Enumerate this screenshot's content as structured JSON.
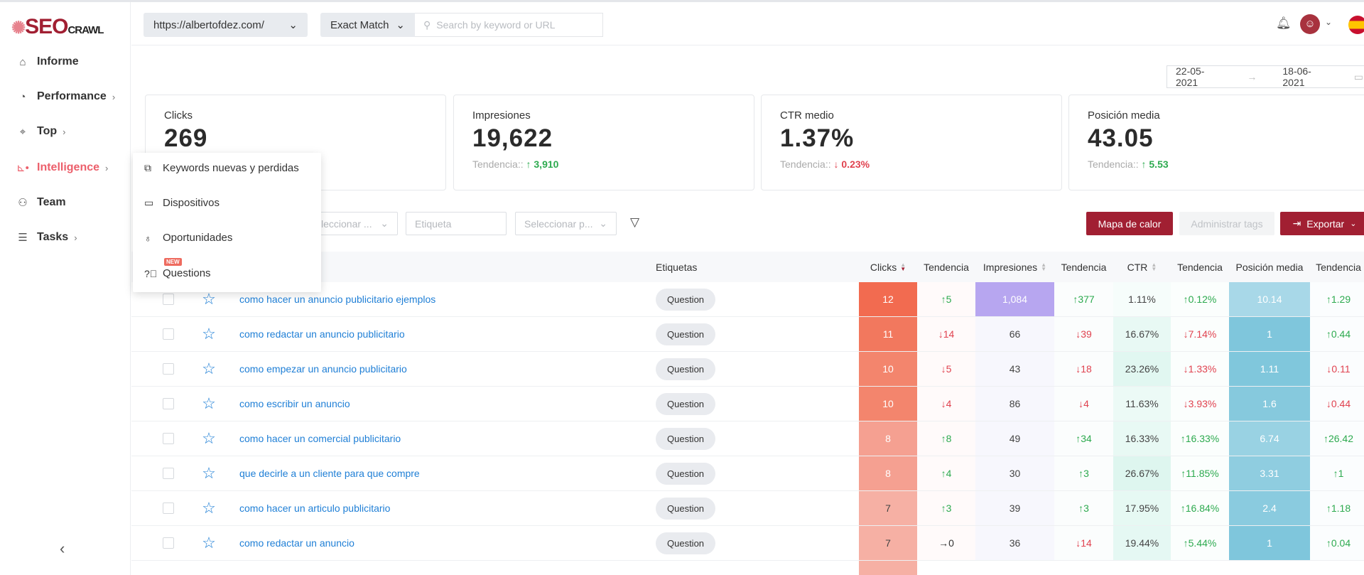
{
  "brand": {
    "logo_text": "SEO",
    "logo_sub": "CRAWL"
  },
  "sidebar": {
    "items": [
      {
        "label": "Informe",
        "icon": "home-icon",
        "has_chevron": false
      },
      {
        "label": "Performance",
        "icon": "gauge-icon",
        "has_chevron": true
      },
      {
        "label": "Top",
        "icon": "target-icon",
        "has_chevron": true
      },
      {
        "label": "Intelligence",
        "icon": "chart-icon",
        "has_chevron": true,
        "active": true
      },
      {
        "label": "Team",
        "icon": "team-icon",
        "has_chevron": false
      },
      {
        "label": "Tasks",
        "icon": "list-icon",
        "has_chevron": true
      }
    ]
  },
  "header": {
    "site": "https://albertofdez.com/",
    "match": "Exact Match",
    "search_placeholder": "Search by keyword or URL"
  },
  "date_range": {
    "start": "22-05-2021",
    "end": "18-06-2021"
  },
  "stats": [
    {
      "label": "Clicks",
      "value": "269",
      "trend_label": "",
      "trend": ""
    },
    {
      "label": "Impresiones",
      "value": "19,622",
      "trend_label": "Tendencia::",
      "trend": "↑ 3,910",
      "dir": "up"
    },
    {
      "label": "CTR medio",
      "value": "1.37%",
      "trend_label": "Tendencia::",
      "trend": "↓ 0.23%",
      "dir": "down"
    },
    {
      "label": "Posición media",
      "value": "43.05",
      "trend_label": "Tendencia::",
      "trend": "↑ 5.53",
      "dir": "up"
    }
  ],
  "filters": {
    "select1": "leccionar ...",
    "tag_placeholder": "Etiqueta",
    "select2": "Seleccionar p..."
  },
  "actions": {
    "heatmap": "Mapa de calor",
    "manage_tags": "Administrar tags",
    "export": "Exportar"
  },
  "menu": {
    "items": [
      {
        "label": "Keywords nuevas y perdidas",
        "icon": "keyword-chart-icon"
      },
      {
        "label": "Dispositivos",
        "icon": "laptop-icon"
      },
      {
        "label": "Oportunidades",
        "icon": "lightbulb-icon"
      },
      {
        "label": "Questions",
        "icon": "question-circle-icon",
        "badge": "NEW"
      }
    ]
  },
  "table": {
    "headers": {
      "tags": "Etiquetas",
      "clicks": "Clicks",
      "trend": "Tendencia",
      "impressions": "Impresiones",
      "ctr": "CTR",
      "position": "Posición media"
    },
    "colors": {
      "up": "#2daa4f",
      "down": "#e0424f",
      "clicks_max": "#f26b50",
      "impr_max": "#b7a6f0",
      "pos": "#7fc6dc"
    },
    "rows": [
      {
        "keyword": "como hacer un anuncio publicitario ejemplos",
        "tag": "Question",
        "clicks": 12,
        "clicks_trend": "↑5",
        "impressions": "1,084",
        "impr_trend": "↑377",
        "ctr": "1.11%",
        "ctr_trend": "↑0.12%",
        "position": "10.14",
        "pos_trend": "↑1.29"
      },
      {
        "keyword": "como redactar un anuncio publicitario",
        "tag": "Question",
        "clicks": 11,
        "clicks_trend": "↓14",
        "impressions": "66",
        "impr_trend": "↓39",
        "ctr": "16.67%",
        "ctr_trend": "↓7.14%",
        "position": "1",
        "pos_trend": "↑0.44"
      },
      {
        "keyword": "como empezar un anuncio publicitario",
        "tag": "Question",
        "clicks": 10,
        "clicks_trend": "↓5",
        "impressions": "43",
        "impr_trend": "↓18",
        "ctr": "23.26%",
        "ctr_trend": "↓1.33%",
        "position": "1.11",
        "pos_trend": "↓0.11"
      },
      {
        "keyword": "como escribir un anuncio",
        "tag": "Question",
        "clicks": 10,
        "clicks_trend": "↓4",
        "impressions": "86",
        "impr_trend": "↓4",
        "ctr": "11.63%",
        "ctr_trend": "↓3.93%",
        "position": "1.6",
        "pos_trend": "↓0.44"
      },
      {
        "keyword": "como hacer un comercial publicitario",
        "tag": "Question",
        "clicks": 8,
        "clicks_trend": "↑8",
        "impressions": "49",
        "impr_trend": "↑34",
        "ctr": "16.33%",
        "ctr_trend": "↑16.33%",
        "position": "6.74",
        "pos_trend": "↑26.42"
      },
      {
        "keyword": "que decirle a un cliente para que compre",
        "tag": "Question",
        "clicks": 8,
        "clicks_trend": "↑4",
        "impressions": "30",
        "impr_trend": "↑3",
        "ctr": "26.67%",
        "ctr_trend": "↑11.85%",
        "position": "3.31",
        "pos_trend": "↑1"
      },
      {
        "keyword": "como hacer un articulo publicitario",
        "tag": "Question",
        "clicks": 7,
        "clicks_trend": "↑3",
        "impressions": "39",
        "impr_trend": "↑3",
        "ctr": "17.95%",
        "ctr_trend": "↑16.84%",
        "position": "2.4",
        "pos_trend": "↑1.18"
      },
      {
        "keyword": "como redactar un anuncio",
        "tag": "Question",
        "clicks": 7,
        "clicks_trend": "→0",
        "impressions": "36",
        "impr_trend": "↓14",
        "ctr": "19.44%",
        "ctr_trend": "↑5.44%",
        "position": "1",
        "pos_trend": "↑0.04"
      }
    ]
  }
}
